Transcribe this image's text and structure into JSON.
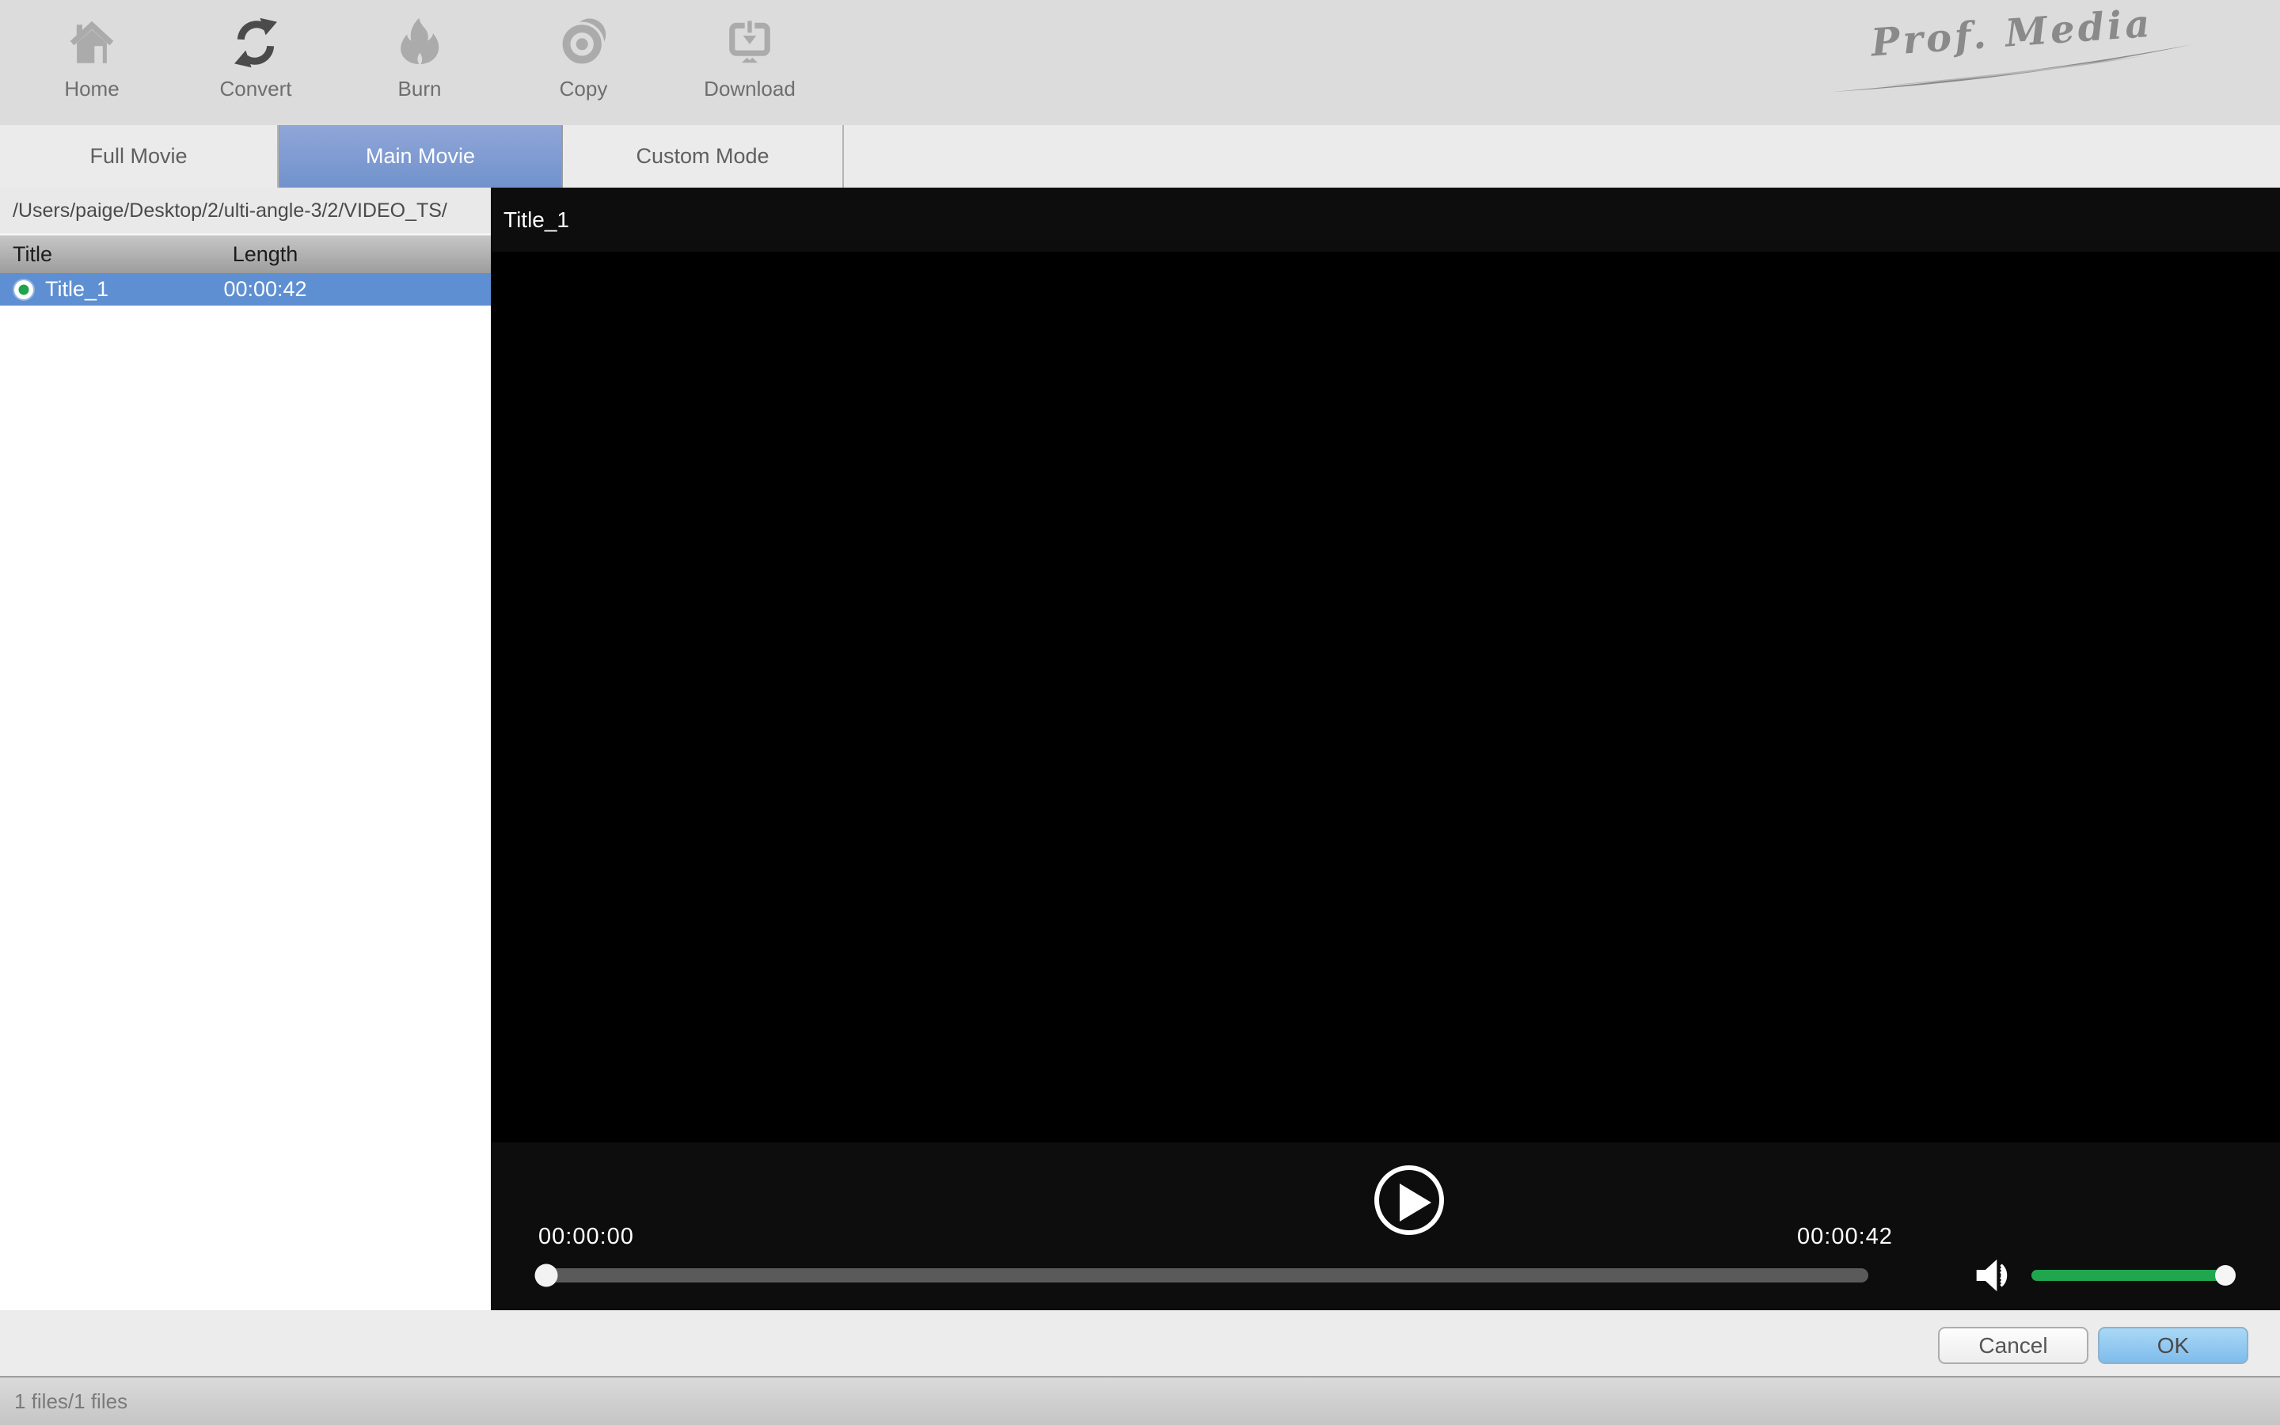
{
  "toolbar": {
    "items": [
      {
        "label": "Home",
        "icon": "home-icon",
        "active": false
      },
      {
        "label": "Convert",
        "icon": "convert-icon",
        "active": true
      },
      {
        "label": "Burn",
        "icon": "burn-icon",
        "active": false
      },
      {
        "label": "Copy",
        "icon": "copy-icon",
        "active": false
      },
      {
        "label": "Download",
        "icon": "download-icon",
        "active": false
      }
    ],
    "logo_text": "Prof. Media"
  },
  "tabs": {
    "items": [
      {
        "label": "Full Movie",
        "active": false
      },
      {
        "label": "Main Movie",
        "active": true
      },
      {
        "label": "Custom Mode",
        "active": false
      }
    ]
  },
  "source_panel": {
    "path": "/Users/paige/Desktop/2/ulti-angle-3/2/VIDEO_TS/",
    "columns": {
      "title": "Title",
      "length": "Length"
    },
    "rows": [
      {
        "title": "Title_1",
        "length": "00:00:42",
        "selected": true
      }
    ]
  },
  "player": {
    "title": "Title_1",
    "current_time": "00:00:00",
    "total_time": "00:00:42",
    "progress_percent": 0,
    "volume_percent": 100
  },
  "footer": {
    "cancel_label": "Cancel",
    "ok_label": "OK"
  },
  "status_bar": {
    "text": "1 files/1 files"
  },
  "colors": {
    "accent_blue": "#5e8fd2",
    "tab_blue_top": "#8fa6d8",
    "tab_blue_bottom": "#7192cc",
    "volume_green": "#1fa64f",
    "ok_top": "#a9d8f5",
    "ok_bottom": "#7fbcec"
  }
}
